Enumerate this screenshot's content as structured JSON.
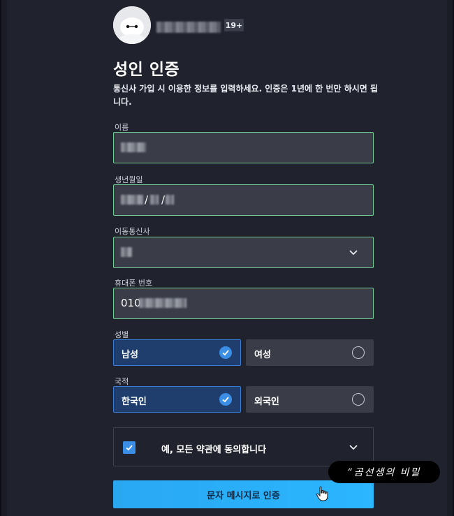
{
  "profile": {
    "age_badge": "19+",
    "avatar_icon": "baymax-avatar-icon"
  },
  "page": {
    "title": "성인 인증",
    "description": "통신사 가입 시 이용한 정보를 입력하세요. 인증은 1년에 한 번만 하시면 됩니다."
  },
  "form": {
    "name": {
      "label": "이름"
    },
    "birth": {
      "label": "생년월일",
      "separator1": "/",
      "separator2": "/"
    },
    "carrier": {
      "label": "이동통신사"
    },
    "phone": {
      "label": "휴대폰 번호",
      "prefix": "010"
    },
    "gender": {
      "label": "성별",
      "options": [
        {
          "label": "남성",
          "selected": true
        },
        {
          "label": "여성",
          "selected": false
        }
      ]
    },
    "nationality": {
      "label": "국적",
      "options": [
        {
          "label": "한국인",
          "selected": true
        },
        {
          "label": "외국인",
          "selected": false
        }
      ]
    },
    "agree": {
      "label": "예, 모든 약관에 동의합니다",
      "checked": true
    },
    "submit_label": "문자 메시지로 인증"
  },
  "watermark": {
    "text": "“곰선생의 비밀"
  },
  "colors": {
    "background": "#20232d",
    "field_border": "#6fcf97",
    "selected_bg": "#1f3e6e",
    "accent": "#3a8ee6",
    "button": "#2bb6ff"
  }
}
